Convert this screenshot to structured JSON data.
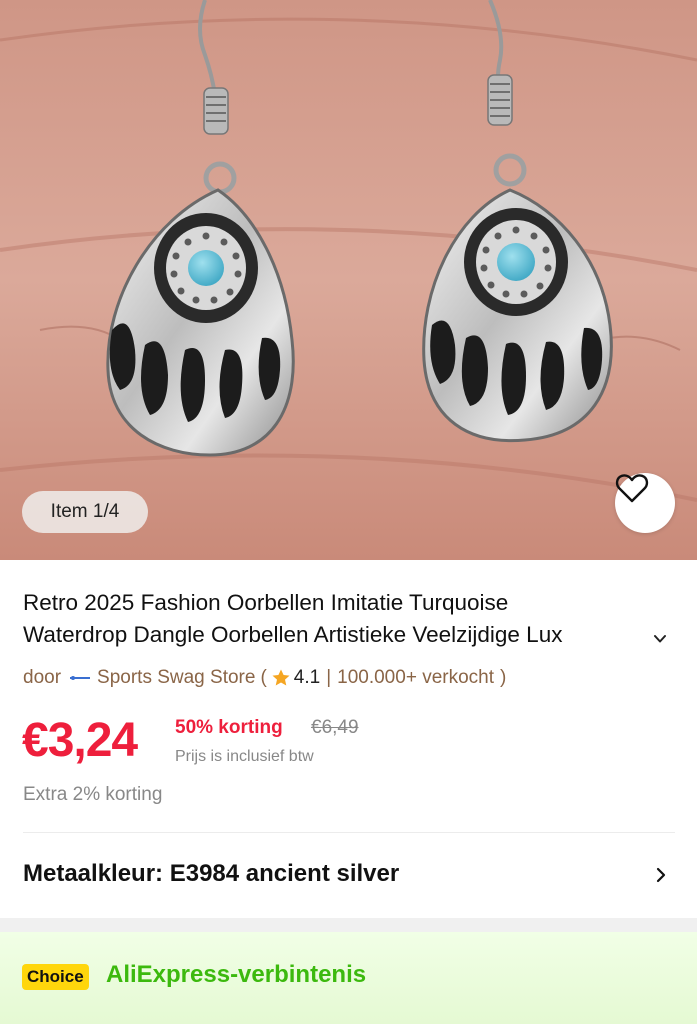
{
  "hero": {
    "item_counter": "Item 1/4",
    "wishlist_icon": "heart-outline-icon"
  },
  "product": {
    "title_line1": "Retro 2025 Fashion Oorbellen Imitatie Turquoise",
    "title_line2": "Waterdrop Dangle Oorbellen Artistieke Veelzijdige Lux",
    "expand_icon": "chevron-down-icon"
  },
  "store": {
    "prefix": "door",
    "name": "Sports Swag Store",
    "open_paren": "(",
    "rating": "4.1",
    "separator": "|",
    "sold": "100.000+ verkocht",
    "close_paren": ")",
    "star_color": "#f5a623"
  },
  "pricing": {
    "current_price": "€3,24",
    "discount_label": "50% korting",
    "original_price": "€6,49",
    "tax_note": "Prijs is inclusief btw",
    "extra_discount": "Extra 2% korting",
    "accent_color": "#ee1f3c"
  },
  "variant": {
    "label": "Metaalkleur: E3984 ancient silver",
    "chevron_icon": "chevron-right-icon"
  },
  "choice": {
    "badge": "Choice",
    "title": "AliExpress-verbintenis",
    "badge_color": "#ffd60c",
    "title_color": "#3cb90e"
  }
}
